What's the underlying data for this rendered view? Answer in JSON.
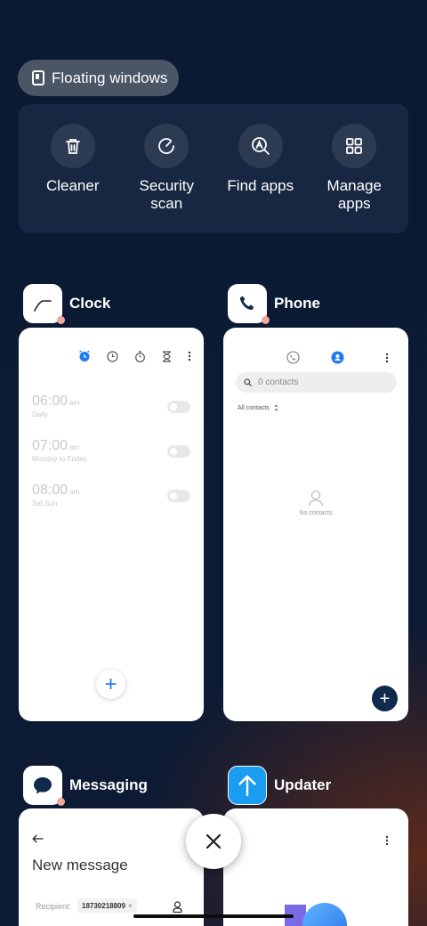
{
  "floating": {
    "label": "Floating windows"
  },
  "tools": [
    {
      "label": "Cleaner",
      "icon": "trash-icon"
    },
    {
      "label": "Security scan",
      "icon": "security-scan-icon"
    },
    {
      "label": "Find apps",
      "icon": "find-apps-icon"
    },
    {
      "label": "Manage apps",
      "icon": "manage-apps-icon"
    }
  ],
  "apps": {
    "clock": {
      "name": "Clock",
      "alarms": [
        {
          "time": "06:00",
          "ampm": "am",
          "repeat": "Daily"
        },
        {
          "time": "07:00",
          "ampm": "am",
          "repeat": "Monday to Friday"
        },
        {
          "time": "08:00",
          "ampm": "am",
          "repeat": "Sat,Sun"
        }
      ],
      "fab": "+"
    },
    "phone": {
      "name": "Phone",
      "search_placeholder": "0 contacts",
      "filter": "All contacts",
      "empty": "No contacts",
      "fab": "+"
    },
    "messaging": {
      "name": "Messaging",
      "title": "New message",
      "recipient_label": "Recipient:",
      "recipient_value": "18730218809",
      "chip_close": "×"
    },
    "updater": {
      "name": "Updater"
    }
  },
  "colors": {
    "accent_blue": "#1e7bf2",
    "fab_navy": "#0f2a4c",
    "updater_blue": "#1a9cf0",
    "background": "#0b1a33"
  }
}
